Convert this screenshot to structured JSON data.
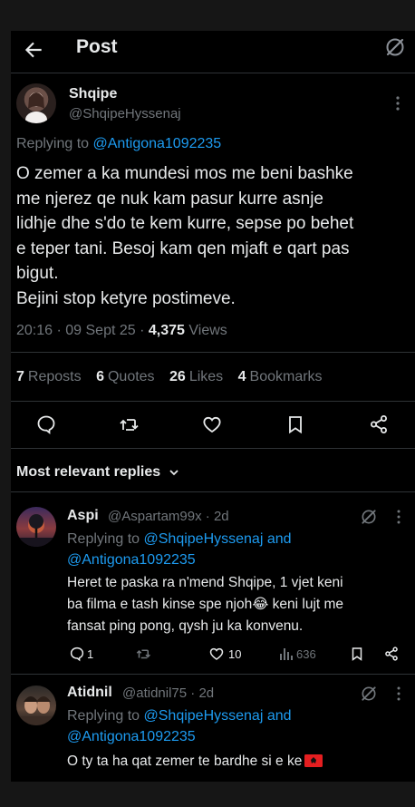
{
  "header": {
    "title": "Post",
    "back_icon": "arrow-left-icon",
    "grok_icon": "grok-icon"
  },
  "post": {
    "author_name": "Shqipe",
    "author_handle": "@ShqipeHyssenaj",
    "replying_prefix": "Replying to",
    "replying_to": "@Antigona1092235",
    "text_lines": [
      "O zemer a ka mundesi mos me beni bashke",
      "me njerez qe nuk kam pasur kurre asnje",
      "lidhje dhe s'do te kem kurre, sepse po behet",
      "e teper tani. Besoj kam qen mjaft e qart pas",
      "bigut.",
      "Bejini stop ketyre postimeve."
    ],
    "time": "20:16",
    "date": "09 Sept 25",
    "views_count": "4,375",
    "views_label": "Views",
    "reposts_count": "7",
    "reposts_label": "Reposts",
    "quotes_count": "6",
    "quotes_label": "Quotes",
    "likes_count": "26",
    "likes_label": "Likes",
    "bookmarks_count": "4",
    "bookmarks_label": "Bookmarks"
  },
  "replies_header": {
    "label": "Most relevant replies"
  },
  "replies": [
    {
      "name": "Aspi",
      "handle": "@Aspartam99x",
      "age": "2d",
      "replying_prefix": "Replying to",
      "replying_to_1": "@ShqipeHyssenaj",
      "replying_and": "and",
      "replying_to_2": "@Antigona1092235",
      "text_line_1": "Heret te paska ra n'mend Shqipe, 1 vjet keni",
      "text_line_2a": "ba filma e tash kinse spe njoh",
      "emoji": "😂",
      "text_line_2b": " keni lujt me",
      "text_line_3": "fansat ping pong, qysh ju ka konvenu.",
      "reply_count": "1",
      "like_count": "10",
      "view_count": "636"
    },
    {
      "name": "Atidnil",
      "handle": "@atidnil75",
      "age": "2d",
      "replying_prefix": "Replying to",
      "replying_to_1": "@ShqipeHyssenaj",
      "replying_and": "and",
      "replying_to_2": "@Antigona1092235",
      "text_line_1": "O ty ta ha qat zemer te bardhe si e ke",
      "flag": "albania-flag-icon"
    }
  ],
  "colors": {
    "accent": "#1d9bf0",
    "text": "#e7e9ea",
    "muted": "#71767b",
    "bg": "#000000"
  }
}
